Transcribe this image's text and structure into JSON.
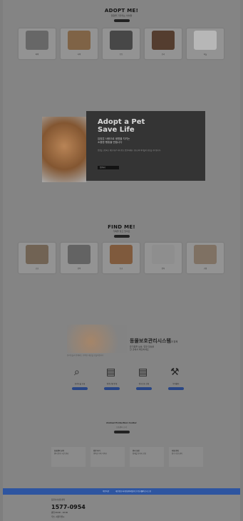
{
  "adopt": {
    "title": "ADOPT ME!",
    "subtitle": "입양을 기다리는 아이들",
    "cards": [
      {
        "color": "#6f6f6f",
        "caption": "파비"
      },
      {
        "color": "#8a6a4a",
        "caption": "나비"
      },
      {
        "color": "#4b4b4b",
        "caption": "토토"
      },
      {
        "color": "#5a4030",
        "caption": "보리"
      },
      {
        "color": "#c8c8c8",
        "caption": "하늘"
      }
    ]
  },
  "hero": {
    "h1_line1": "Adopt a Pet",
    "h1_line2": "Save Life",
    "p_line1": "입양은 사랑으로 생명을 지키는",
    "p_line2": "소중한 행동을 만듭니다",
    "small": "입양을 고민하고 계신가요? 사지 말고 입양하세요. 보호소의 아이들이 당신을 기다립니다.",
    "button": "입양하기"
  },
  "find": {
    "title": "FIND ME!",
    "subtitle": "가족을 찾고 있어요",
    "cards": [
      {
        "color": "#7a6a5a",
        "caption": "코코"
      },
      {
        "color": "#6a6a6a",
        "caption": "콩이"
      },
      {
        "color": "#8a6040",
        "caption": "초코"
      },
      {
        "color": "#9a9a9a",
        "caption": "뭉치"
      },
      {
        "color": "#8a7a6a",
        "caption": "구름"
      }
    ]
  },
  "org": {
    "title": "동물보호관리시스템",
    "title_suffix": "과 함께",
    "sub_line1": "유기동물 보호, 입양 정보를",
    "sub_line2": "한 곳에서 확인하세요",
    "line": "반려동물과 함께하는 행복한 세상을 만들어갑니다"
  },
  "services": [
    {
      "icon": "search-icon",
      "glyph": "⌕",
      "label": "유기동물 조회"
    },
    {
      "icon": "document-icon",
      "glyph": "▤",
      "label": "입양신청 안내"
    },
    {
      "icon": "document-icon",
      "glyph": "▤",
      "label": "임시보호 신청"
    },
    {
      "icon": "hammer-icon",
      "glyph": "⚒",
      "label": "봉사활동"
    }
  ],
  "news": {
    "title": "Animal Protection Center",
    "subtitle": "보호센터 소식"
  },
  "boxes": [
    {
      "title": "보호센터 공지",
      "body": "센터 운영 시간 안내"
    },
    {
      "title": "입양 후기",
      "body": "행복한 가족 이야기"
    },
    {
      "title": "봉사 모집",
      "body": "함께할 봉사자 모집"
    },
    {
      "title": "후원 안내",
      "body": "정기 후원 참여"
    }
  ],
  "bluebar": [
    "이용약관",
    "개인정보처리방침",
    "이메일무단수집거부",
    "찾아오시는길"
  ],
  "footer": {
    "label": "동물보호상담센터",
    "phone": "1577-0954",
    "hours": "평일 09:00 - 18:00",
    "addr": "주소: 서울특별시"
  },
  "colors": {
    "accent_blue": "#2e55a0",
    "hero_panel": "#363636"
  }
}
